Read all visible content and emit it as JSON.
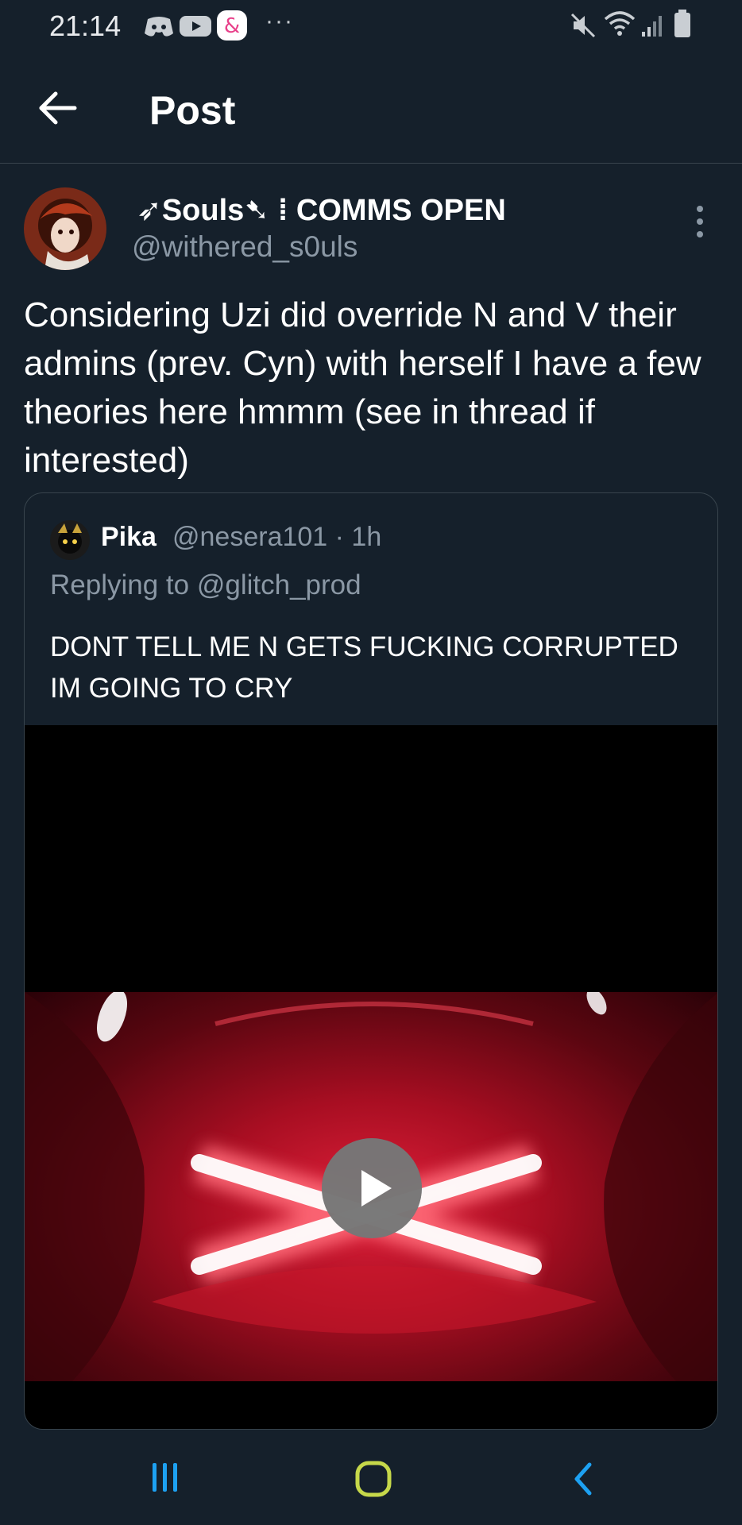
{
  "status_bar": {
    "time": "21:14",
    "left_icons": [
      "discord-icon",
      "youtube-icon",
      "app-ampersand-icon"
    ],
    "overflow": "···",
    "right_icons": [
      "mute-icon",
      "wifi-icon",
      "signal-icon",
      "battery-icon"
    ]
  },
  "header": {
    "back_icon": "arrow-left-icon",
    "title": "Post"
  },
  "tweet": {
    "author_name": "➶Souls➷ ⁞ COMMS OPEN",
    "author_handle": "@withered_s0uls",
    "text": "Considering Uzi did override N and V their admins (prev. Cyn) with herself I have a few theories here hmmm (see in thread if interested)"
  },
  "quote": {
    "name": "Pika",
    "handle_time": "@nesera101 · 1h",
    "reply_to": "Replying to @glitch_prod",
    "text": "DONT TELL ME N GETS FUCKING CORRUPTED IM GOING TO CRY",
    "media": {
      "type": "video",
      "play_icon": "play-icon"
    }
  },
  "nav_bar": {
    "recents_icon": "recents-icon",
    "home_icon": "home-icon",
    "back_icon": "back-chevron-icon",
    "colors": {
      "recents": "#1da1f2",
      "home": "#c6d84a",
      "back": "#1da1f2"
    }
  },
  "colors": {
    "background": "#15202b",
    "secondary_text": "#8b98a5",
    "border": "#38444d"
  }
}
